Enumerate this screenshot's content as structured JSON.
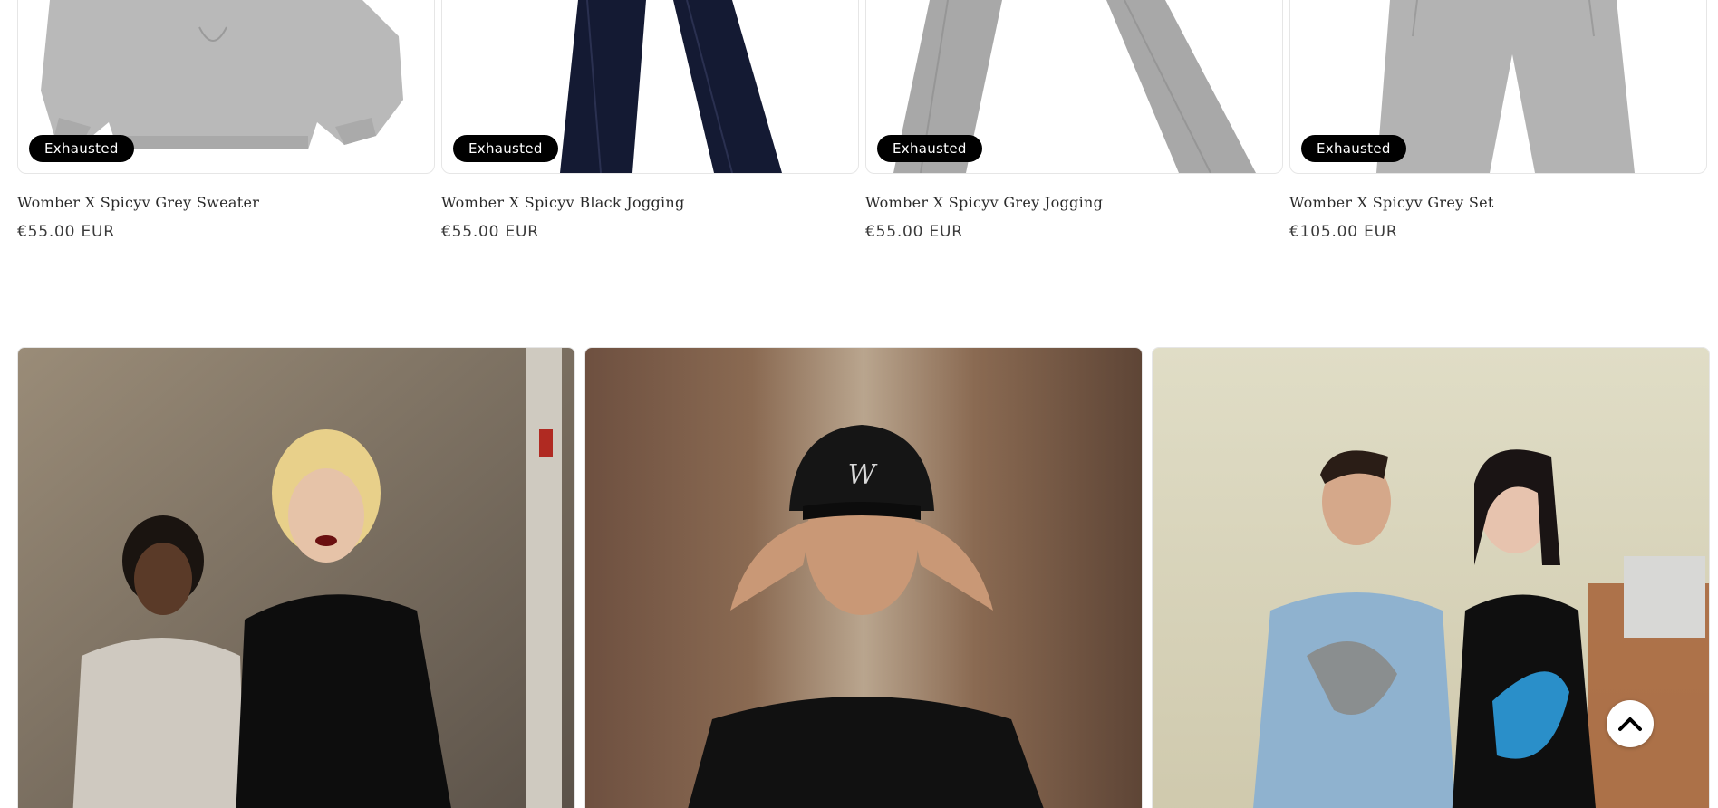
{
  "products": [
    {
      "title": "Womber X Spicyv Grey Sweater",
      "price": "€55.00 EUR",
      "badge": "Exhausted",
      "garment": "sweater",
      "color": "#b9b9b9"
    },
    {
      "title": "Womber X Spicyv Black Jogging",
      "price": "€55.00 EUR",
      "badge": "Exhausted",
      "garment": "jogging",
      "color": "#141a33"
    },
    {
      "title": "Womber X Spicyv Grey Jogging",
      "price": "€55.00 EUR",
      "badge": "Exhausted",
      "garment": "jogging",
      "color": "#a8a8a8"
    },
    {
      "title": "Womber X Spicyv Grey Set",
      "price": "€105.00 EUR",
      "badge": "Exhausted",
      "garment": "shorts",
      "color": "#b3b3b3"
    }
  ],
  "lookbook": [
    {
      "scene": "hoodie-duo",
      "bg": "#8a7e6e"
    },
    {
      "scene": "cap-portrait",
      "bg": "#7a5a45"
    },
    {
      "scene": "sweater-duo",
      "bg": "#d9d6bf"
    }
  ],
  "back_to_top": {
    "icon": "chevron-up-icon"
  }
}
